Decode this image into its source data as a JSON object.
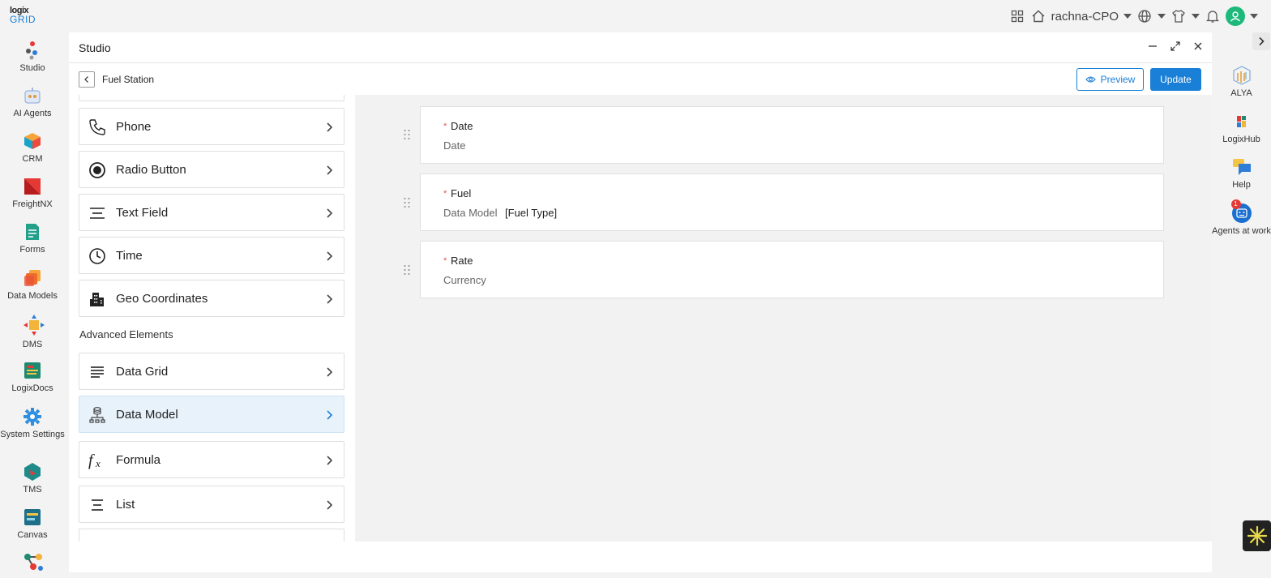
{
  "brand": {
    "line1": "logix",
    "line2": "GRID"
  },
  "topbar": {
    "workspace": "rachna-CPO",
    "icons": [
      "apps-grid-icon",
      "home-icon",
      "globe-icon",
      "tshirt-icon",
      "bell-icon",
      "user-avatar-icon"
    ]
  },
  "leftnav": [
    {
      "label": "Studio",
      "icon": "studio-icon"
    },
    {
      "label": "AI Agents",
      "icon": "ai-agents-icon"
    },
    {
      "label": "CRM",
      "icon": "crm-icon"
    },
    {
      "label": "FreightNX",
      "icon": "freightnx-icon"
    },
    {
      "label": "Forms",
      "icon": "forms-icon"
    },
    {
      "label": "Data Models",
      "icon": "data-models-icon"
    },
    {
      "label": "DMS",
      "icon": "dms-icon"
    },
    {
      "label": "LogixDocs",
      "icon": "logixdocs-icon"
    },
    {
      "label": "System Settings",
      "icon": "settings-icon"
    },
    {
      "label": "TMS",
      "icon": "tms-icon"
    },
    {
      "label": "Canvas",
      "icon": "canvas-icon"
    }
  ],
  "studio": {
    "title": "Studio",
    "form_name": "Fuel Station",
    "preview_label": "Preview",
    "update_label": "Update"
  },
  "elements": {
    "basic": [
      {
        "label": "Phone",
        "icon": "phone-icon"
      },
      {
        "label": "Radio Button",
        "icon": "radio-icon"
      },
      {
        "label": "Text Field",
        "icon": "text-field-icon"
      },
      {
        "label": "Time",
        "icon": "clock-icon"
      },
      {
        "label": "Geo Coordinates",
        "icon": "building-icon"
      }
    ],
    "advanced_title": "Advanced Elements",
    "advanced": [
      {
        "label": "Data Grid",
        "icon": "grid-lines-icon"
      },
      {
        "label": "Data Model",
        "icon": "data-model-icon",
        "active": true
      },
      {
        "label": "Formula",
        "icon": "formula-icon"
      },
      {
        "label": "List",
        "icon": "list-icon"
      }
    ]
  },
  "fields": [
    {
      "name": "Date",
      "required_mark": "*",
      "type": "Date",
      "value": ""
    },
    {
      "name": "Fuel",
      "required_mark": "*",
      "type": "Data Model",
      "value": "[Fuel Type]"
    },
    {
      "name": "Rate",
      "required_mark": "*",
      "type": "Currency",
      "value": ""
    }
  ],
  "rightnav": [
    {
      "label": "ALYA",
      "icon": "alya-icon"
    },
    {
      "label": "LogixHub",
      "icon": "logixhub-icon"
    },
    {
      "label": "Help",
      "icon": "help-chat-icon"
    },
    {
      "label": "Agents at work",
      "icon": "agents-at-work-icon",
      "badge": "1"
    }
  ],
  "colors": {
    "accent": "#1a7fd6",
    "active_row": "#e8f2fb",
    "required": "#e05555"
  }
}
